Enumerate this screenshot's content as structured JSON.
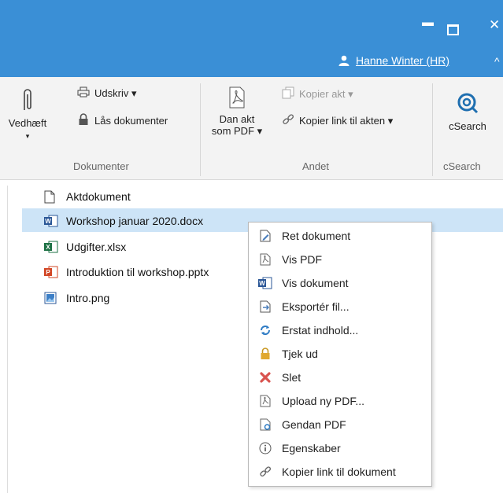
{
  "window": {
    "minimize_glyph": "▬",
    "close_glyph": "✕"
  },
  "user": {
    "name": "Hanne Winter (HR)"
  },
  "ribbon": {
    "dokumenter": {
      "label": "Dokumenter",
      "attach": "Vedhæft",
      "print": "Udskriv ▾",
      "lock": "Lås dokumenter"
    },
    "andet": {
      "label": "Andet",
      "pdf_line1": "Dan akt",
      "pdf_line2": "som PDF ▾",
      "copy_act": "Kopier akt ▾",
      "copy_link": "Kopier link til akten ▾"
    },
    "csearch": {
      "label": "cSearch",
      "button": "cSearch"
    }
  },
  "files": [
    {
      "name": "Aktdokument",
      "type": "doc"
    },
    {
      "name": "Workshop januar 2020.docx",
      "type": "docx"
    },
    {
      "name": "Udgifter.xlsx",
      "type": "xlsx"
    },
    {
      "name": "Introduktion til workshop.pptx",
      "type": "pptx"
    },
    {
      "name": "Intro.png",
      "type": "png"
    }
  ],
  "context_menu": [
    {
      "label": "Ret dokument",
      "icon": "edit-document-icon"
    },
    {
      "label": "Vis PDF",
      "icon": "pdf-icon"
    },
    {
      "label": "Vis dokument",
      "icon": "word-icon"
    },
    {
      "label": "Eksportér fil...",
      "icon": "export-icon"
    },
    {
      "label": "Erstat indhold...",
      "icon": "replace-icon"
    },
    {
      "label": "Tjek ud",
      "icon": "lock-icon"
    },
    {
      "label": "Slet",
      "icon": "delete-icon"
    },
    {
      "label": "Upload ny PDF...",
      "icon": "upload-pdf-icon"
    },
    {
      "label": "Gendan PDF",
      "icon": "restore-pdf-icon"
    },
    {
      "label": "Egenskaber",
      "icon": "info-icon"
    },
    {
      "label": "Kopier link til dokument",
      "icon": "link-icon"
    }
  ],
  "colors": {
    "titlebar": "#3a8fd6",
    "selection": "#cde4f7"
  }
}
